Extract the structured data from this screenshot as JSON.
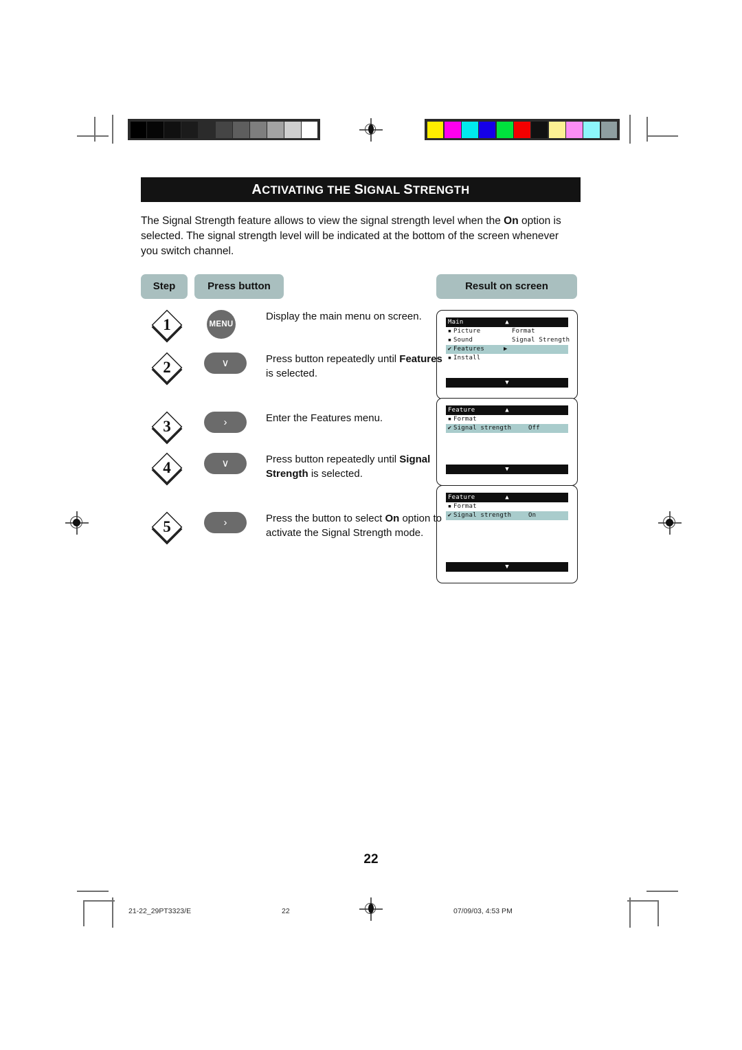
{
  "document": {
    "title_leading": "A",
    "title_rest_1": "CTIVATING THE ",
    "title_s1": "S",
    "title_rest_2": "IGNAL ",
    "title_s2": "S",
    "title_rest_3": "TRENGTH",
    "title_plain": "ACTIVATING THE SIGNAL STRENGTH",
    "intro_part1": "The Signal Strength feature allows to view the signal strength level when the ",
    "intro_bold": "On",
    "intro_part2": " option is selected. The signal strength level will be indicated at the bottom of the screen whenever you switch channel.",
    "page_number": "22"
  },
  "table": {
    "head_step": "Step",
    "head_press": "Press button",
    "head_result": "Result on screen"
  },
  "steps": [
    {
      "number": "1",
      "button_label": "MENU",
      "button_kind": "menu",
      "desc_pre": "Display the main menu on screen.",
      "desc_bold": "",
      "desc_post": ""
    },
    {
      "number": "2",
      "button_label": "∨",
      "button_kind": "down",
      "desc_pre": "Press button repeatedly until ",
      "desc_bold": "Features",
      "desc_post": " is selected."
    },
    {
      "number": "3",
      "button_label": "›",
      "button_kind": "right",
      "desc_pre": "Enter the Features menu.",
      "desc_bold": "",
      "desc_post": ""
    },
    {
      "number": "4",
      "button_label": "∨",
      "button_kind": "down",
      "desc_pre": "Press button repeatedly until ",
      "desc_bold": "Signal Strength",
      "desc_post": " is selected."
    },
    {
      "number": "5",
      "button_label": "›",
      "button_kind": "right",
      "desc_pre": "Press the button to select ",
      "desc_bold": "On",
      "desc_post": " option to activate the Signal Strength mode."
    }
  ],
  "screens": [
    {
      "header": "Main",
      "up_caret": "▲",
      "down_caret": "▼",
      "rows": [
        {
          "mark": "▪",
          "label": "Picture",
          "col2": "Format",
          "arrow": "",
          "value": "",
          "highlight": false
        },
        {
          "mark": "▪",
          "label": "Sound",
          "col2": "Signal Strength",
          "arrow": "",
          "value": "",
          "highlight": false
        },
        {
          "mark": "✔",
          "label": "Features",
          "col2": "",
          "arrow": "▶",
          "value": "",
          "highlight": true
        },
        {
          "mark": "▪",
          "label": "Install",
          "col2": "",
          "arrow": "",
          "value": "",
          "highlight": false
        }
      ]
    },
    {
      "header": "Feature",
      "up_caret": "▲",
      "down_caret": "▼",
      "rows": [
        {
          "mark": "▪",
          "label": "Format",
          "col2": "",
          "arrow": "",
          "value": "",
          "highlight": false
        },
        {
          "mark": "✔",
          "label": "Signal strength",
          "col2": "",
          "arrow": "",
          "value": "Off",
          "highlight": true
        }
      ]
    },
    {
      "header": "Feature",
      "up_caret": "▲",
      "down_caret": "▼",
      "rows": [
        {
          "mark": "▪",
          "label": "Format",
          "col2": "",
          "arrow": "",
          "value": "",
          "highlight": false
        },
        {
          "mark": "✔",
          "label": "Signal strength",
          "col2": "",
          "arrow": "",
          "value": "On",
          "highlight": true
        }
      ]
    }
  ],
  "footer": {
    "file_id": "21-22_29PT3323/E",
    "sheet_number": "22",
    "timestamp": "07/09/03, 4:53 PM"
  },
  "calibration": {
    "grayscale": [
      "#000000",
      "#060606",
      "#101010",
      "#1b1b1b",
      "#2b2b2b",
      "#454545",
      "#5e5e5e",
      "#7e7e7e",
      "#a3a3a3",
      "#cfcfcf",
      "#ffffff"
    ],
    "colors": [
      "#ffee00",
      "#ff00ee",
      "#00e9ee",
      "#1500e8",
      "#00e23d",
      "#f40000",
      "#111111",
      "#fcf194",
      "#fb8ef5",
      "#8df6fb",
      "#8e9ea0"
    ]
  },
  "theme": {
    "pill_bg": "#a9bfbf",
    "highlight_bg": "#a9cccc",
    "button_bg": "#6b6b6b",
    "title_bg": "#131313"
  }
}
